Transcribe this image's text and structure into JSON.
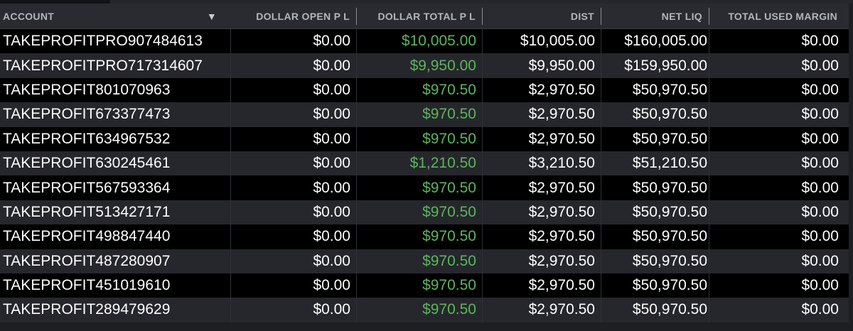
{
  "columns": [
    {
      "label": "ACCOUNT"
    },
    {
      "label": "DOLLAR OPEN P L"
    },
    {
      "label": "DOLLAR TOTAL P L"
    },
    {
      "label": "DIST"
    },
    {
      "label": "NET LIQ"
    },
    {
      "label": "TOTAL USED MARGIN"
    }
  ],
  "sort_icon": "sort-down-triangle",
  "sort_glyph": "▼",
  "colors": {
    "positive": "#5cb55c",
    "text": "#ffffff",
    "header_text": "#b3b6bd"
  },
  "rows": [
    {
      "account": "TAKEPROFITPRO907484613",
      "open_pl": "$0.00",
      "total_pl": "$10,005.00",
      "dist": "$10,005.00",
      "net_liq": "$160,005.00",
      "margin": "$0.00"
    },
    {
      "account": "TAKEPROFITPRO717314607",
      "open_pl": "$0.00",
      "total_pl": "$9,950.00",
      "dist": "$9,950.00",
      "net_liq": "$159,950.00",
      "margin": "$0.00"
    },
    {
      "account": "TAKEPROFIT801070963",
      "open_pl": "$0.00",
      "total_pl": "$970.50",
      "dist": "$2,970.50",
      "net_liq": "$50,970.50",
      "margin": "$0.00"
    },
    {
      "account": "TAKEPROFIT673377473",
      "open_pl": "$0.00",
      "total_pl": "$970.50",
      "dist": "$2,970.50",
      "net_liq": "$50,970.50",
      "margin": "$0.00"
    },
    {
      "account": "TAKEPROFIT634967532",
      "open_pl": "$0.00",
      "total_pl": "$970.50",
      "dist": "$2,970.50",
      "net_liq": "$50,970.50",
      "margin": "$0.00"
    },
    {
      "account": "TAKEPROFIT630245461",
      "open_pl": "$0.00",
      "total_pl": "$1,210.50",
      "dist": "$3,210.50",
      "net_liq": "$51,210.50",
      "margin": "$0.00"
    },
    {
      "account": "TAKEPROFIT567593364",
      "open_pl": "$0.00",
      "total_pl": "$970.50",
      "dist": "$2,970.50",
      "net_liq": "$50,970.50",
      "margin": "$0.00"
    },
    {
      "account": "TAKEPROFIT513427171",
      "open_pl": "$0.00",
      "total_pl": "$970.50",
      "dist": "$2,970.50",
      "net_liq": "$50,970.50",
      "margin": "$0.00"
    },
    {
      "account": "TAKEPROFIT498847440",
      "open_pl": "$0.00",
      "total_pl": "$970.50",
      "dist": "$2,970.50",
      "net_liq": "$50,970.50",
      "margin": "$0.00"
    },
    {
      "account": "TAKEPROFIT487280907",
      "open_pl": "$0.00",
      "total_pl": "$970.50",
      "dist": "$2,970.50",
      "net_liq": "$50,970.50",
      "margin": "$0.00"
    },
    {
      "account": "TAKEPROFIT451019610",
      "open_pl": "$0.00",
      "total_pl": "$970.50",
      "dist": "$2,970.50",
      "net_liq": "$50,970.50",
      "margin": "$0.00"
    },
    {
      "account": "TAKEPROFIT289479629",
      "open_pl": "$0.00",
      "total_pl": "$970.50",
      "dist": "$2,970.50",
      "net_liq": "$50,970.50",
      "margin": "$0.00"
    }
  ]
}
